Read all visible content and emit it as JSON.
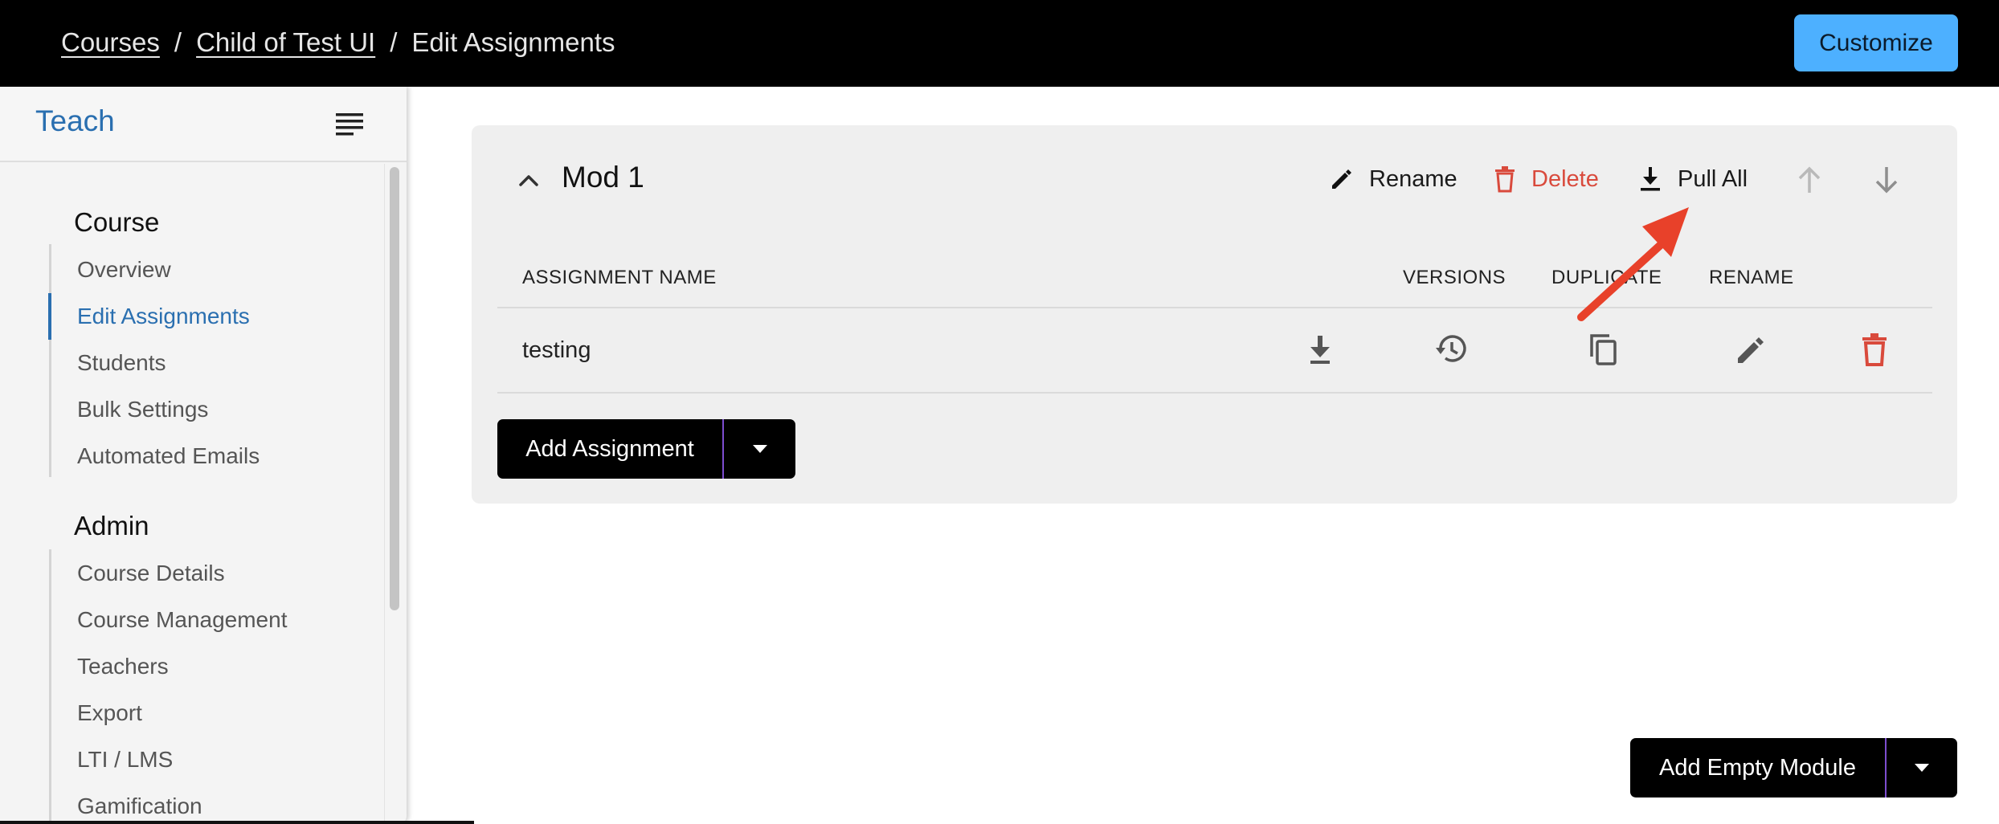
{
  "breadcrumb": {
    "items": [
      "Courses",
      "Child of Test UI",
      "Edit Assignments"
    ],
    "separator": "/"
  },
  "header": {
    "customize_label": "Customize"
  },
  "sidebar": {
    "title": "Teach",
    "course_section": {
      "title": "Course",
      "items": [
        "Overview",
        "Edit Assignments",
        "Students",
        "Bulk Settings",
        "Automated Emails"
      ],
      "active": "Edit Assignments"
    },
    "admin_section": {
      "title": "Admin",
      "items": [
        "Course Details",
        "Course Management",
        "Teachers",
        "Export",
        "LTI / LMS",
        "Gamification"
      ]
    }
  },
  "module": {
    "title": "Mod 1",
    "actions": {
      "rename": "Rename",
      "delete": "Delete",
      "pull_all": "Pull All"
    },
    "columns": {
      "name": "ASSIGNMENT NAME",
      "versions": "VERSIONS",
      "duplicate": "DUPLICATE",
      "rename": "RENAME"
    },
    "rows": [
      {
        "name": "testing"
      }
    ],
    "add_assignment_label": "Add Assignment"
  },
  "add_empty_module_label": "Add Empty Module",
  "colors": {
    "accent_blue": "#2a6fb0",
    "customize_button": "#4db0ff",
    "delete_red": "#d94a3c",
    "annotation_arrow": "#e8412a",
    "split_divider": "#7d4dcf"
  },
  "icons": {
    "menu": "menu-lines-icon",
    "collapse": "chevron-up-icon",
    "rename": "pencil-icon",
    "delete": "trash-icon",
    "pull_all": "download-icon",
    "move_up": "arrow-up-icon",
    "move_down": "arrow-down-icon",
    "row_pull": "download-icon",
    "row_versions": "history-icon",
    "row_duplicate": "copy-icon",
    "row_rename": "pencil-icon",
    "row_delete": "trash-icon",
    "dropdown": "caret-down-icon"
  }
}
